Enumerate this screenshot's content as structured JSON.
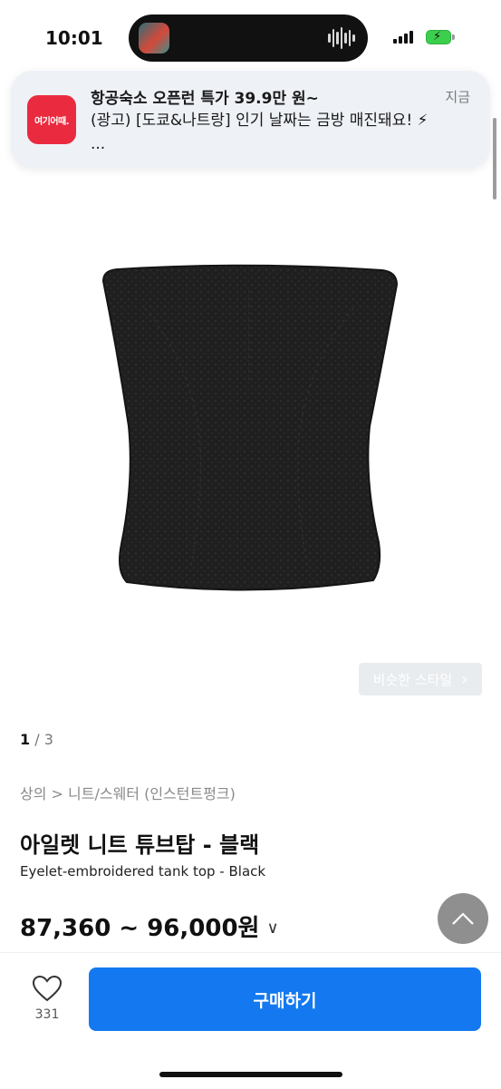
{
  "status_bar": {
    "time": "10:01"
  },
  "notification": {
    "app_icon_label": "여기어때.",
    "title": "항공숙소 오픈런 특가 39.9만 원~",
    "body": "(광고) [도쿄&나트랑] 인기 날짜는 금방 매진돼요! ⚡ ...",
    "time": "지금"
  },
  "product": {
    "similar_style_label": "비슷한 스타일",
    "pager": {
      "current": "1",
      "total": "/ 3"
    },
    "breadcrumb": "상의 > 니트/스웨터 (인스턴트펑크)",
    "title": "아일렛 니트 튜브탑 - 블랙",
    "subtitle": "Eyelet-embroidered tank top - Black",
    "price_range": "87,360 ~ 96,000원"
  },
  "bottom_bar": {
    "like_count": "331",
    "buy_label": "구매하기"
  },
  "colors": {
    "accent": "#1479f0",
    "notification_icon": "#ea2b3f",
    "product": "#1c1c1c"
  }
}
